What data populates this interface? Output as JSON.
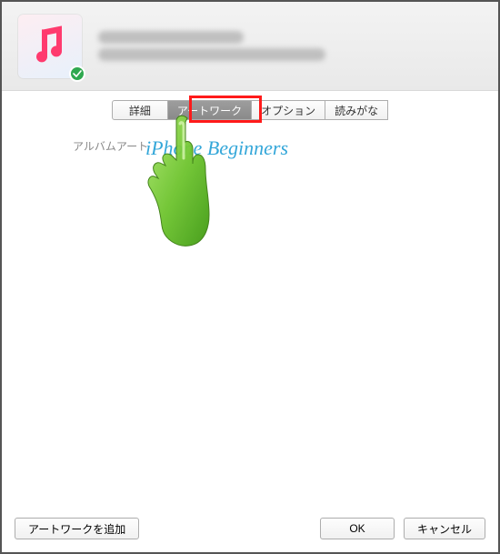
{
  "tabs": {
    "details": "詳細",
    "artwork": "アートワーク",
    "options": "オプション",
    "pronunciation": "読みがな"
  },
  "content": {
    "artwork_label": "アルバムアート",
    "watermark": "iPhone Beginners"
  },
  "footer": {
    "add_artwork": "アートワークを追加",
    "ok": "OK",
    "cancel": "キャンセル"
  }
}
